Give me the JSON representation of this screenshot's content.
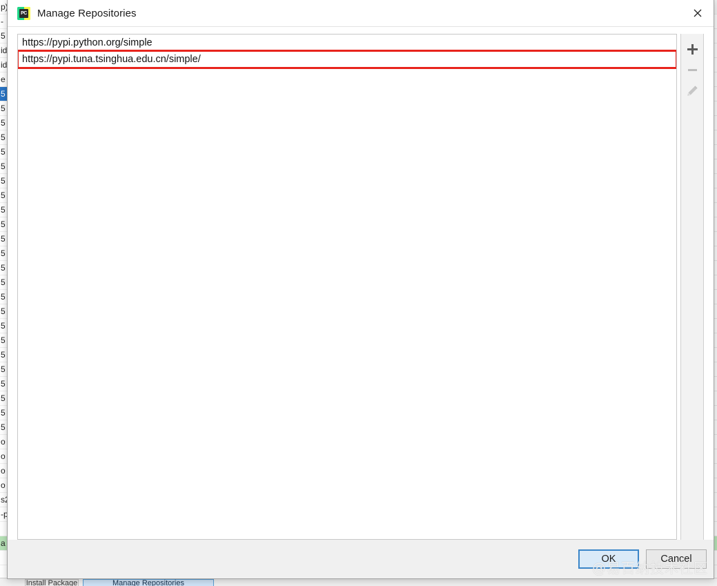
{
  "dialog": {
    "title": "Manage Repositories",
    "icon": "pycharm-logo-icon",
    "icon_text": "PC",
    "close_label": "✕"
  },
  "repositories": {
    "items": [
      {
        "url": "https://pypi.python.org/simple",
        "highlighted": false
      },
      {
        "url": "https://pypi.tuna.tsinghua.edu.cn/simple/",
        "highlighted": true
      }
    ],
    "highlight_color": "#e8241c"
  },
  "side_toolbar": {
    "add": {
      "name": "add-repository-button",
      "glyph": "+",
      "enabled": true
    },
    "remove": {
      "name": "remove-repository-button",
      "glyph": "−",
      "enabled": false
    },
    "edit": {
      "name": "edit-repository-button",
      "glyph": "✎",
      "enabled": false
    }
  },
  "footer": {
    "ok_label": "OK",
    "cancel_label": "Cancel",
    "default_button_color": "#3a85c8"
  },
  "watermark": {
    "text": "@易百纳技术社区"
  },
  "background": {
    "left_rows": [
      {
        "text": "p)",
        "style": "plain"
      },
      {
        "text": "-",
        "style": "plain"
      },
      {
        "text": "5",
        "style": "plain"
      },
      {
        "text": "id",
        "style": "plain"
      },
      {
        "text": "id",
        "style": "plain"
      },
      {
        "text": "e",
        "style": "plain"
      },
      {
        "text": "5",
        "style": "sel"
      },
      {
        "text": "5",
        "style": "plain"
      },
      {
        "text": "5",
        "style": "plain"
      },
      {
        "text": "5",
        "style": "plain"
      },
      {
        "text": "5",
        "style": "plain"
      },
      {
        "text": "5",
        "style": "plain"
      },
      {
        "text": "5",
        "style": "plain"
      },
      {
        "text": "5",
        "style": "plain"
      },
      {
        "text": "5",
        "style": "plain"
      },
      {
        "text": "5",
        "style": "plain"
      },
      {
        "text": "5",
        "style": "plain"
      },
      {
        "text": "5",
        "style": "plain"
      },
      {
        "text": "5",
        "style": "plain"
      },
      {
        "text": "5",
        "style": "plain"
      },
      {
        "text": "5",
        "style": "plain"
      },
      {
        "text": "5",
        "style": "plain"
      },
      {
        "text": "5",
        "style": "plain"
      },
      {
        "text": "5",
        "style": "plain"
      },
      {
        "text": "5",
        "style": "plain"
      },
      {
        "text": "5",
        "style": "plain"
      },
      {
        "text": "5",
        "style": "plain"
      },
      {
        "text": "5",
        "style": "plain"
      },
      {
        "text": "5",
        "style": "plain"
      },
      {
        "text": "5",
        "style": "plain"
      },
      {
        "text": "o",
        "style": "plain"
      },
      {
        "text": "o",
        "style": "plain"
      },
      {
        "text": "o",
        "style": "plain"
      },
      {
        "text": "o",
        "style": "plain"
      },
      {
        "text": "s2",
        "style": "plain"
      },
      {
        "text": "-p",
        "style": "plain"
      },
      {
        "text": "",
        "style": "plain"
      },
      {
        "text": "a",
        "style": "green"
      },
      {
        "text": "",
        "style": "plain"
      }
    ],
    "bottom_bar": {
      "manage_button_label": "Manage Repositories",
      "left_button_label": "Install Package",
      "right_button_label": ""
    }
  }
}
